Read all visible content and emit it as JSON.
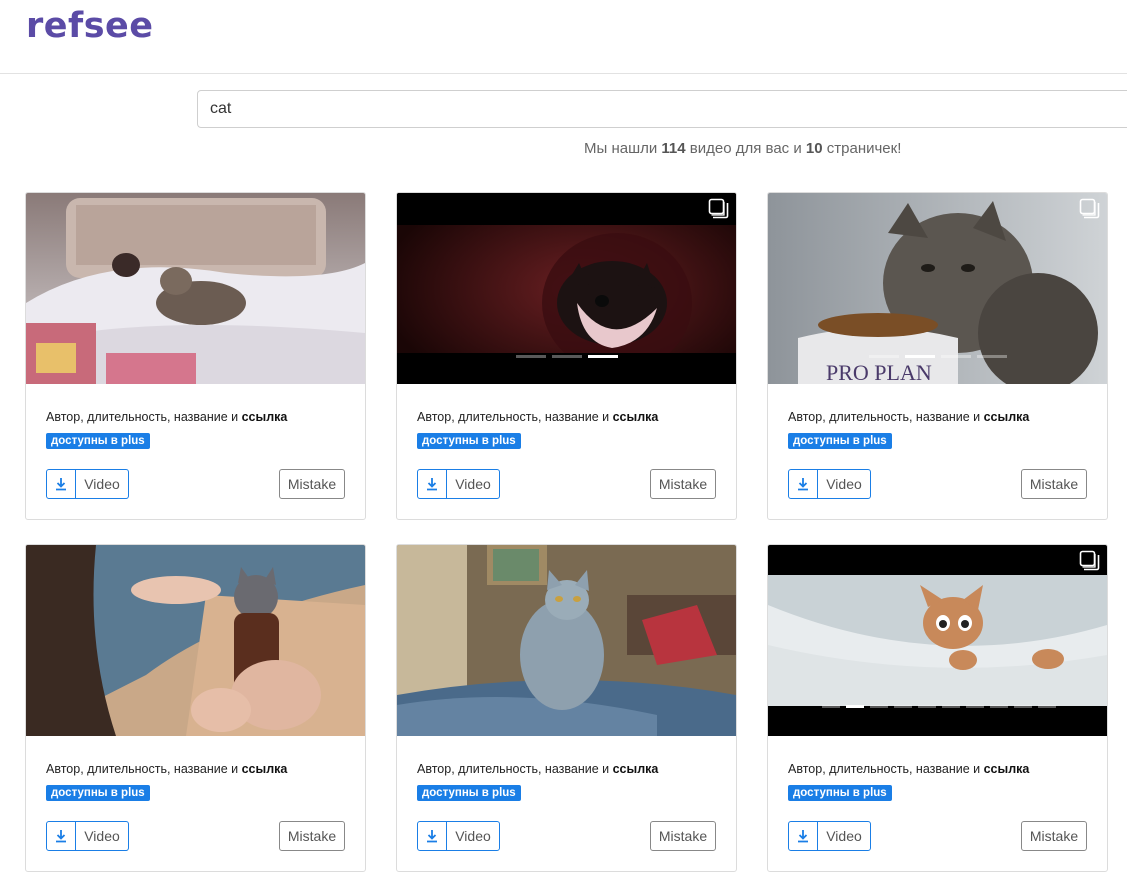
{
  "header": {
    "logo": "refsee"
  },
  "search": {
    "value": "cat"
  },
  "results": {
    "prefix": "Мы нашли",
    "video_count": "114",
    "middle": "видео для вас и",
    "page_count": "10",
    "suffix": "страничек!"
  },
  "card_labels": {
    "meta_text": "Автор, длительность, название и",
    "meta_link": "ссылка",
    "plus_badge": "доступны в plus",
    "video_button": "Video",
    "mistake_button": "Mistake"
  },
  "cards": [
    {
      "multi": false,
      "dots_total": 0,
      "dots_active": -1
    },
    {
      "multi": true,
      "dots_total": 3,
      "dots_active": 2
    },
    {
      "multi": true,
      "dots_total": 4,
      "dots_active": 1
    },
    {
      "multi": false,
      "dots_total": 0,
      "dots_active": -1
    },
    {
      "multi": false,
      "dots_total": 0,
      "dots_active": -1
    },
    {
      "multi": true,
      "dots_total": 10,
      "dots_active": 1
    }
  ],
  "colors": {
    "brand": "#5b4ba6",
    "accent": "#1a7ee6"
  }
}
